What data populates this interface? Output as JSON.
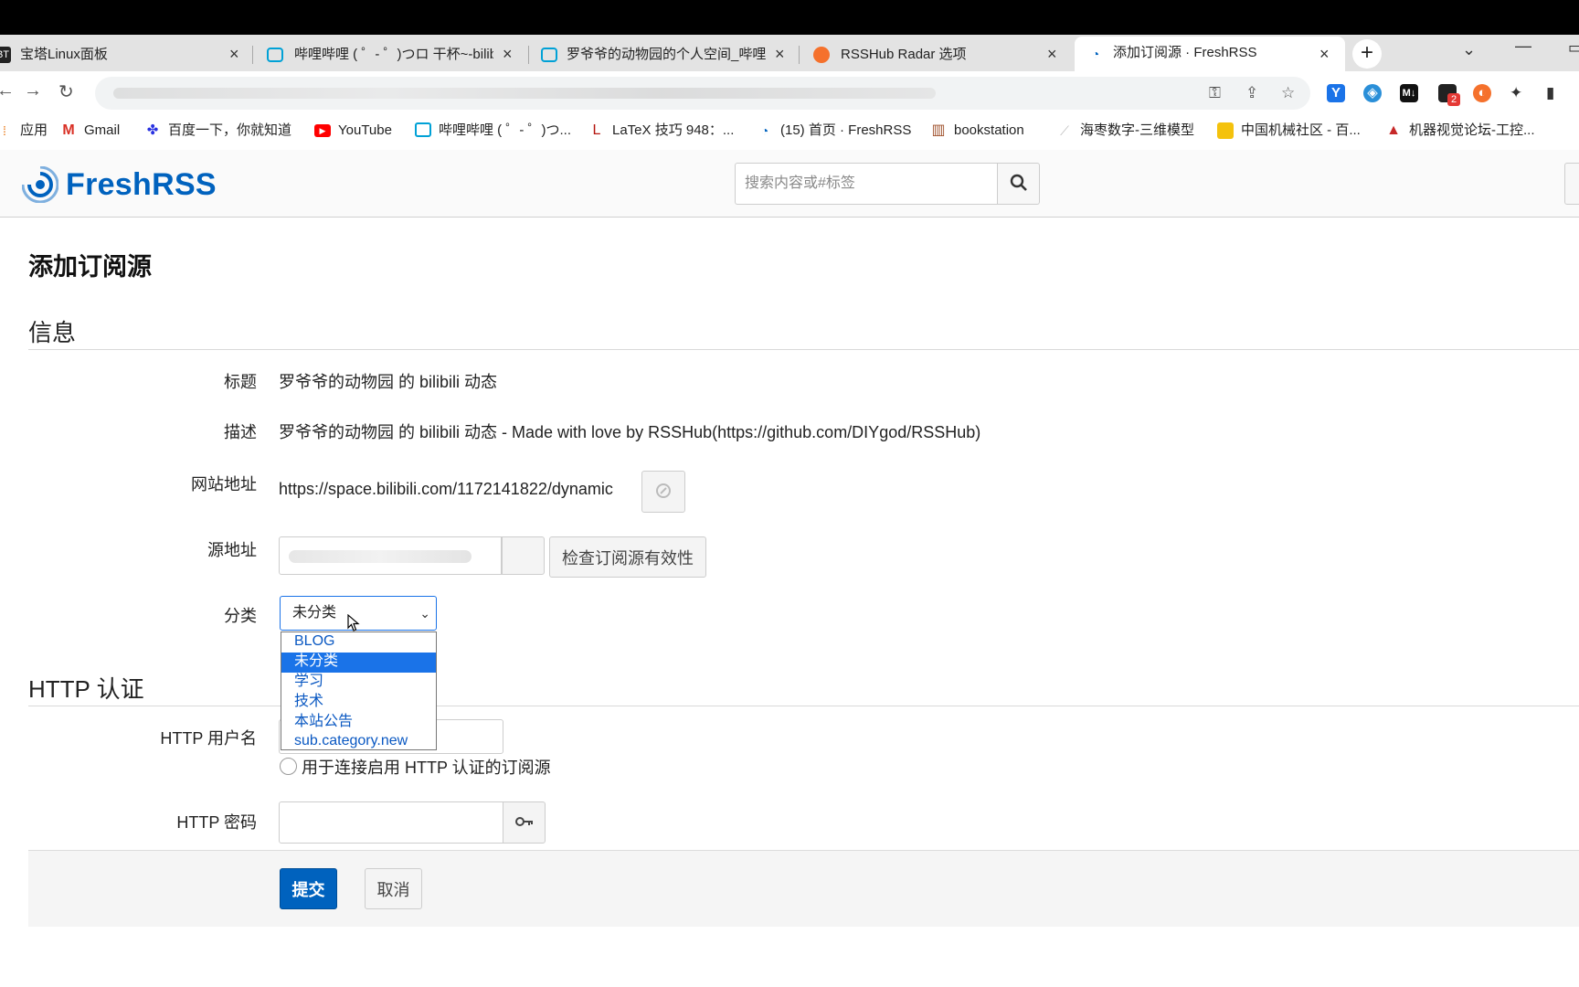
{
  "browser": {
    "tabs": [
      {
        "title": "宝塔Linux面板",
        "favicon": "BT",
        "active": false
      },
      {
        "title": "哔哩哔哩 ( ゜- ゜)つロ 干杯~-bilibili",
        "favicon": "bilibili-icon",
        "active": false
      },
      {
        "title": "罗爷爷的动物园的个人空间_哔哩哔哩",
        "favicon": "bilibili-icon",
        "active": false
      },
      {
        "title": "RSSHub Radar 选项",
        "favicon": "rsshub-icon",
        "active": false
      },
      {
        "title": "添加订阅源 · FreshRSS",
        "favicon": "freshrss-icon",
        "active": true
      }
    ],
    "extensions": [
      "key-icon",
      "share-icon",
      "star-icon",
      "y-extension",
      "shield-extension",
      "markdown-extension",
      "notification-extension",
      "rss-extension",
      "puzzle-icon",
      "sidebar-icon"
    ],
    "ext_badge": "2",
    "bookmarks": [
      {
        "label": "应用",
        "icon": "apps-icon"
      },
      {
        "label": "Gmail",
        "icon": "gmail-icon"
      },
      {
        "label": "百度一下，你就知道",
        "icon": "baidu-icon"
      },
      {
        "label": "YouTube",
        "icon": "youtube-icon"
      },
      {
        "label": "哔哩哔哩 ( ゜- ゜)つ...",
        "icon": "bilibili-icon"
      },
      {
        "label": "LaTeX 技巧 948：...",
        "icon": "latex-icon"
      },
      {
        "label": "(15) 首页 · FreshRSS",
        "icon": "freshrss-icon"
      },
      {
        "label": "bookstation",
        "icon": "books-icon"
      },
      {
        "label": "海枣数字-三维模型",
        "icon": "model-icon"
      },
      {
        "label": "中国机械社区 - 百...",
        "icon": "folder-icon"
      },
      {
        "label": "机器视觉论坛-工控...",
        "icon": "forum-icon"
      }
    ]
  },
  "app": {
    "name": "FreshRSS",
    "search_placeholder": "搜索内容或#标签",
    "brand_color": "#0062be"
  },
  "page": {
    "title": "添加订阅源",
    "info_section": "信息",
    "fields": {
      "title_label": "标题",
      "title_value": "罗爷爷的动物园 的 bilibili 动态",
      "desc_label": "描述",
      "desc_value": "罗爷爷的动物园 的 bilibili 动态 - Made with love by RSSHub(https://github.com/DIYgod/RSSHub)",
      "site_label": "网站地址",
      "site_value": "https://space.bilibili.com/1172141822/dynamic",
      "feed_label": "源地址",
      "check_button": "检查订阅源有效性",
      "category_label": "分类",
      "category_selected": "未分类"
    },
    "category_options": [
      "BLOG",
      "未分类",
      "学习",
      "技术",
      "本站公告",
      "sub.category.new"
    ],
    "http_section": "HTTP 认证",
    "http_user_label": "HTTP 用户名",
    "http_help": "用于连接启用 HTTP 认证的订阅源",
    "http_pass_label": "HTTP 密码",
    "submit": "提交",
    "cancel": "取消"
  }
}
